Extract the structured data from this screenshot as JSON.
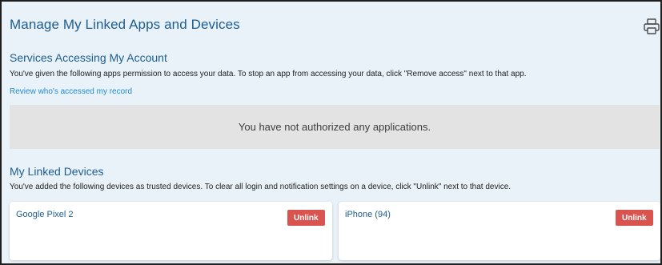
{
  "header": {
    "title": "Manage My Linked Apps and Devices",
    "print_icon": "printer-icon"
  },
  "services": {
    "title": "Services Accessing My Account",
    "description": "You've given the following apps permission to access your data. To stop an app from accessing your data, click \"Remove access\" next to that app.",
    "review_link": "Review who's accessed my record",
    "empty_message": "You have not authorized any applications."
  },
  "devices": {
    "title": "My Linked Devices",
    "description": "You've added the following devices as trusted devices. To clear all login and notification settings on a device, click \"Unlink\" next to that device.",
    "items": [
      {
        "name": "Google Pixel 2",
        "action": "Unlink"
      },
      {
        "name": "iPhone (94)",
        "action": "Unlink"
      }
    ]
  },
  "colors": {
    "background": "#e9f2f9",
    "heading": "#1d5d90",
    "link": "#1f8ad0",
    "unlink_button": "#d9534f",
    "empty_box": "#e3e3e3"
  }
}
